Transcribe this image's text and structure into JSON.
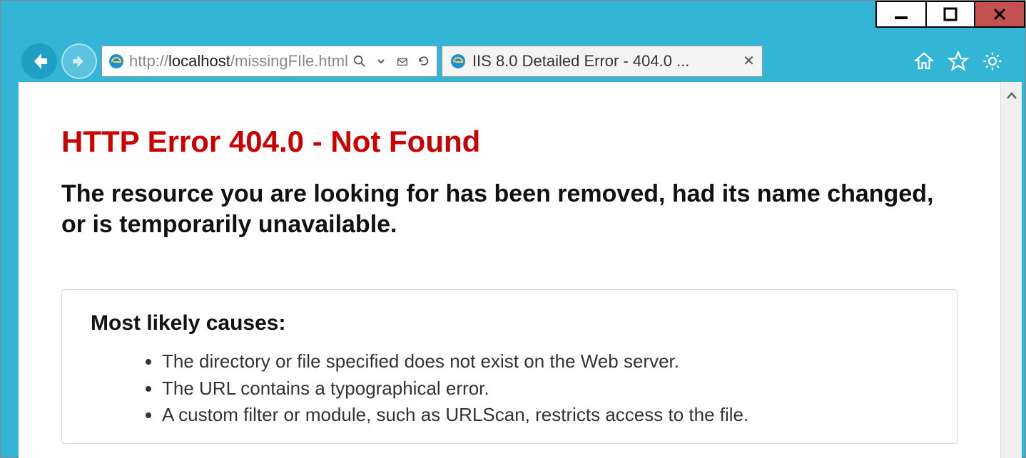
{
  "window": {
    "minimize_glyph": "—",
    "maximize_glyph": "◻",
    "close_glyph": "✕"
  },
  "nav": {
    "url_prefix": "http://",
    "url_host": "localhost",
    "url_path": "/missingFIle.html"
  },
  "tab": {
    "title": "IIS 8.0 Detailed Error - 404.0 ..."
  },
  "page": {
    "error_heading": "HTTP Error 404.0 - Not Found",
    "error_sub": "The resource you are looking for has been removed, had its name changed, or is temporarily unavailable.",
    "causes_heading": "Most likely causes:",
    "causes": [
      "The directory or file specified does not exist on the Web server.",
      "The URL contains a typographical error.",
      "A custom filter or module, such as URLScan, restricts access to the file."
    ]
  }
}
